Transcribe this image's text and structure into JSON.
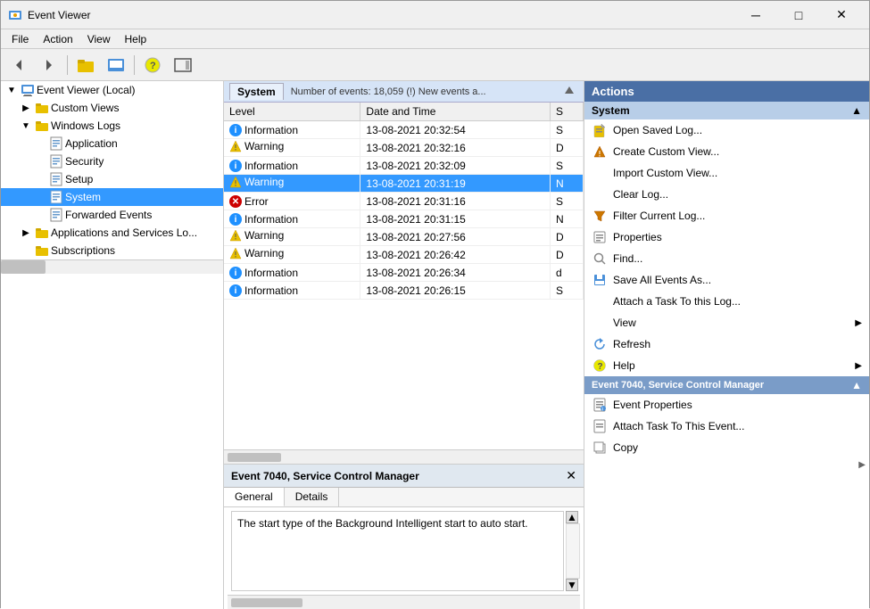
{
  "titleBar": {
    "title": "Event Viewer",
    "icon": "event-viewer-icon"
  },
  "menuBar": {
    "items": [
      "File",
      "Action",
      "View",
      "Help"
    ]
  },
  "toolbar": {
    "buttons": [
      "back",
      "forward",
      "up-folder",
      "show-hide-console",
      "help",
      "show-hide-action"
    ]
  },
  "leftPane": {
    "tree": [
      {
        "id": "root",
        "label": "Event Viewer (Local)",
        "level": 0,
        "expanded": true,
        "toggle": ""
      },
      {
        "id": "custom-views",
        "label": "Custom Views",
        "level": 1,
        "expanded": false,
        "toggle": "▶"
      },
      {
        "id": "windows-logs",
        "label": "Windows Logs",
        "level": 1,
        "expanded": true,
        "toggle": "▼"
      },
      {
        "id": "application",
        "label": "Application",
        "level": 2,
        "toggle": ""
      },
      {
        "id": "security",
        "label": "Security",
        "level": 2,
        "toggle": ""
      },
      {
        "id": "setup",
        "label": "Setup",
        "level": 2,
        "toggle": ""
      },
      {
        "id": "system",
        "label": "System",
        "level": 2,
        "toggle": "",
        "selected": true
      },
      {
        "id": "forwarded",
        "label": "Forwarded Events",
        "level": 2,
        "toggle": ""
      },
      {
        "id": "app-services",
        "label": "Applications and Services Lo...",
        "level": 1,
        "toggle": "▶"
      },
      {
        "id": "subscriptions",
        "label": "Subscriptions",
        "level": 1,
        "toggle": ""
      }
    ]
  },
  "centerPane": {
    "tab": "System",
    "eventCount": "Number of events: 18,059 (!) New events a...",
    "columns": [
      "Level",
      "Date and Time",
      "S"
    ],
    "events": [
      {
        "level": "Information",
        "levelType": "info",
        "datetime": "13-08-2021 20:32:54",
        "source": "S"
      },
      {
        "level": "Warning",
        "levelType": "warn",
        "datetime": "13-08-2021 20:32:16",
        "source": "D"
      },
      {
        "level": "Information",
        "levelType": "info",
        "datetime": "13-08-2021 20:32:09",
        "source": "S"
      },
      {
        "level": "Warning",
        "levelType": "warn",
        "datetime": "13-08-2021 20:31:19",
        "source": "N"
      },
      {
        "level": "Error",
        "levelType": "error",
        "datetime": "13-08-2021 20:31:16",
        "source": "S"
      },
      {
        "level": "Information",
        "levelType": "info",
        "datetime": "13-08-2021 20:31:15",
        "source": "N"
      },
      {
        "level": "Warning",
        "levelType": "warn",
        "datetime": "13-08-2021 20:27:56",
        "source": "D"
      },
      {
        "level": "Warning",
        "levelType": "warn",
        "datetime": "13-08-2021 20:26:42",
        "source": "D"
      },
      {
        "level": "Information",
        "levelType": "info",
        "datetime": "13-08-2021 20:26:34",
        "source": "d"
      },
      {
        "level": "Information",
        "levelType": "info",
        "datetime": "13-08-2021 20:26:15",
        "source": "S"
      }
    ]
  },
  "detailPane": {
    "title": "Event 7040, Service Control Manager",
    "tabs": [
      "General",
      "Details"
    ],
    "activeTab": "General",
    "content": "The start type of the Background Intelligent start to auto start."
  },
  "rightPane": {
    "header": "Actions",
    "sections": [
      {
        "id": "system-section",
        "label": "System",
        "collapsed": false,
        "items": [
          {
            "label": "Open Saved Log...",
            "icon": "open-log-icon",
            "hasSubmenu": false
          },
          {
            "label": "Create Custom View...",
            "icon": "create-view-icon",
            "hasSubmenu": false
          },
          {
            "label": "Import Custom View...",
            "icon": "",
            "hasSubmenu": false
          },
          {
            "label": "Clear Log...",
            "icon": "",
            "hasSubmenu": false
          },
          {
            "label": "Filter Current Log...",
            "icon": "filter-icon",
            "hasSubmenu": false
          },
          {
            "label": "Properties",
            "icon": "properties-icon",
            "hasSubmenu": false
          },
          {
            "label": "Find...",
            "icon": "find-icon",
            "hasSubmenu": false
          },
          {
            "label": "Save All Events As...",
            "icon": "save-icon",
            "hasSubmenu": false
          },
          {
            "label": "Attach a Task To this Log...",
            "icon": "",
            "hasSubmenu": false
          },
          {
            "label": "View",
            "icon": "",
            "hasSubmenu": true
          },
          {
            "label": "Refresh",
            "icon": "refresh-icon",
            "hasSubmenu": false
          },
          {
            "label": "Help",
            "icon": "help-icon",
            "hasSubmenu": true
          }
        ]
      },
      {
        "id": "event-section",
        "label": "Event 7040, Service Control Manager",
        "collapsed": false,
        "highlighted": true,
        "items": [
          {
            "label": "Event Properties",
            "icon": "event-props-icon",
            "hasSubmenu": false
          },
          {
            "label": "Attach Task To This Event...",
            "icon": "attach-task-icon",
            "hasSubmenu": false
          },
          {
            "label": "Copy",
            "icon": "copy-icon",
            "hasSubmenu": false
          }
        ]
      }
    ]
  }
}
